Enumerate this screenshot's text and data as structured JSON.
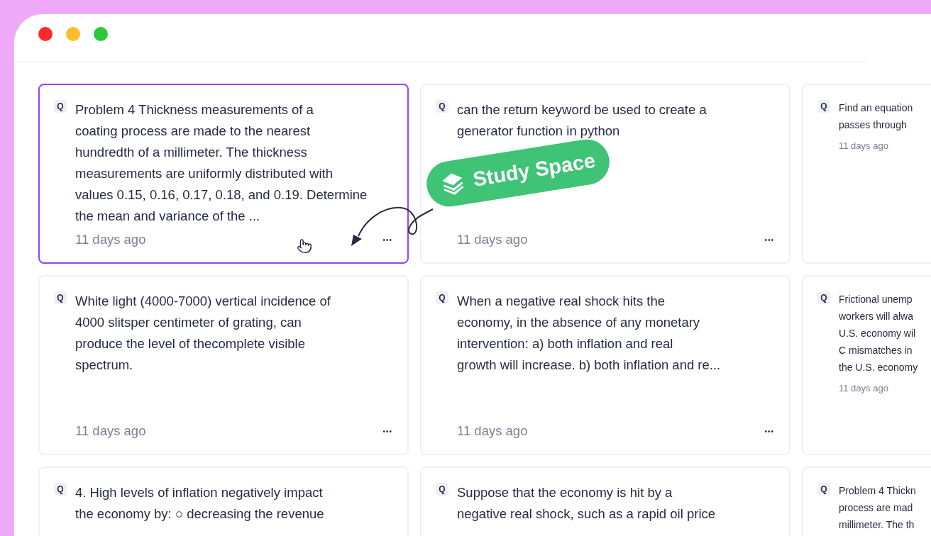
{
  "window": {
    "controls": [
      {
        "color": "#fe2a2a"
      },
      {
        "color": "#fdbd2e"
      },
      {
        "color": "#2bc938"
      }
    ]
  },
  "cards": [
    {
      "badge": "Q",
      "selected": true,
      "compact": false,
      "lines": [
        "Problem 4 Thickness measurements of a",
        "coating process are made to the nearest",
        "hundredth of a millimeter. The thickness",
        "measurements are uniformly distributed with",
        "values 0.15, 0.16, 0.17, 0.18, and 0.19. Determine",
        "the mean and variance of the ..."
      ],
      "time": "11 days ago",
      "menu": "•••"
    },
    {
      "badge": "Q",
      "selected": false,
      "compact": false,
      "lines": [
        "can the return keyword be used to create a",
        "generator function in python"
      ],
      "time": "11 days ago",
      "menu": "•••"
    },
    {
      "badge": "Q",
      "selected": false,
      "compact": true,
      "lines": [
        "Find an equation",
        "passes through"
      ],
      "time": "11 days ago"
    },
    {
      "badge": "Q",
      "selected": false,
      "compact": false,
      "lines": [
        "White light (4000-7000) vertical incidence of",
        "4000 slitsper centimeter of grating, can",
        "produce the level of thecomplete visible",
        "spectrum."
      ],
      "time": "11 days ago",
      "menu": "•••"
    },
    {
      "badge": "Q",
      "selected": false,
      "compact": false,
      "lines": [
        "When a negative real shock hits the",
        "economy, in the absence of any monetary",
        "intervention: a) both inflation and real",
        "growth will increase. b) both inflation and re..."
      ],
      "time": "11 days ago",
      "menu": "•••"
    },
    {
      "badge": "Q",
      "selected": false,
      "compact": true,
      "lines": [
        "Frictional unemp",
        "workers will alwa",
        "U.S. economy wil",
        "C mismatches in",
        "the U.S. economy"
      ],
      "time": "11 days ago"
    },
    {
      "badge": "Q",
      "selected": false,
      "compact": false,
      "lines": [
        "4. High levels of inflation negatively impact",
        "the economy by: ○ decreasing the revenue"
      ]
    },
    {
      "badge": "Q",
      "selected": false,
      "compact": false,
      "lines": [
        "Suppose that the economy is hit by a",
        "negative real shock, such as a rapid oil price"
      ]
    },
    {
      "badge": "Q",
      "selected": false,
      "compact": true,
      "lines": [
        "Problem 4 Thickn",
        "process are mad",
        "millimeter. The th"
      ]
    }
  ],
  "promo": {
    "label": "Study Space"
  }
}
